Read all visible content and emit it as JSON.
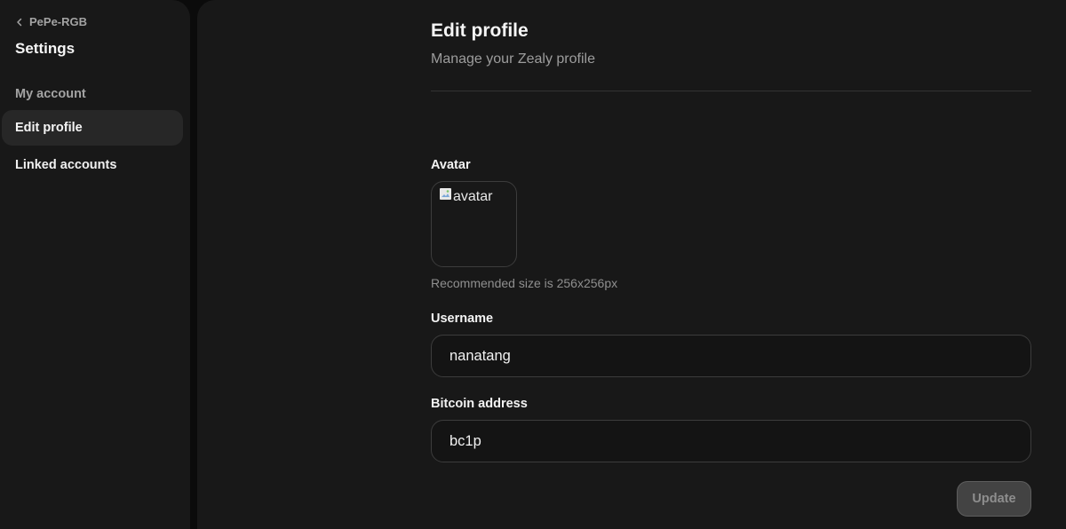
{
  "sidebar": {
    "back_label": "PePe-RGB",
    "title": "Settings",
    "items": [
      {
        "label": "My account",
        "state": "muted"
      },
      {
        "label": "Edit profile",
        "state": "active"
      },
      {
        "label": "Linked accounts",
        "state": "normal"
      }
    ]
  },
  "main": {
    "title": "Edit profile",
    "subtitle": "Manage your Zealy profile",
    "avatar": {
      "label": "Avatar",
      "alt_text": "avatar",
      "hint": "Recommended size is 256x256px"
    },
    "username": {
      "label": "Username",
      "value": "nanatang"
    },
    "bitcoin": {
      "label": "Bitcoin address",
      "value": "bc1p"
    },
    "update_button": "Update"
  },
  "colors": {
    "background": "#181818",
    "page_background": "#0b0b0b",
    "active_nav": "#272727",
    "muted_text": "#9d9d9d",
    "border": "#3c3c3c",
    "disabled_button": "#434343"
  },
  "icons": {
    "back": "chevron-left-icon",
    "avatar_fallback": "broken-image-icon"
  }
}
